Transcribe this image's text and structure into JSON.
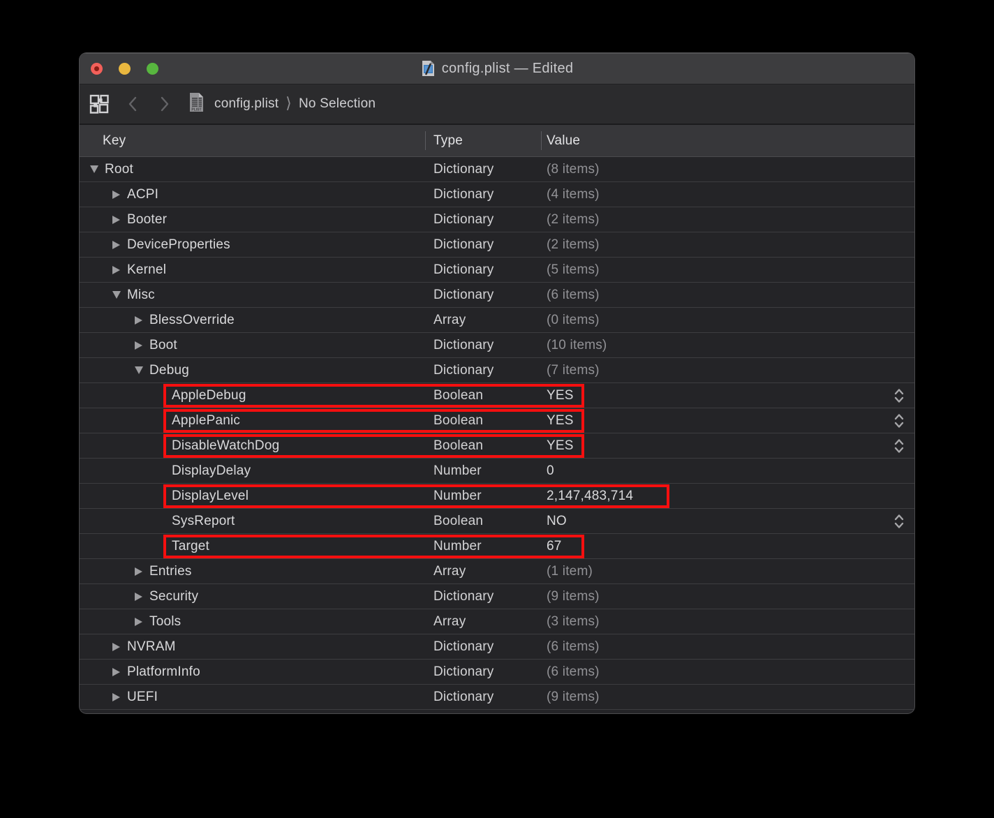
{
  "window": {
    "title": "config.plist — Edited"
  },
  "toolbar": {
    "breadcrumb": [
      {
        "label": "config.plist"
      },
      {
        "label": "No Selection"
      }
    ],
    "separator": "⟩"
  },
  "table": {
    "columns": [
      {
        "label": "Key"
      },
      {
        "label": "Type"
      },
      {
        "label": "Value"
      }
    ],
    "rows": [
      {
        "key": "Root",
        "type": "Dictionary",
        "value": "(8 items)",
        "indent": 0,
        "disclosure": "open",
        "stepper": false,
        "highlight": null
      },
      {
        "key": "ACPI",
        "type": "Dictionary",
        "value": "(4 items)",
        "indent": 1,
        "disclosure": "closed",
        "stepper": false,
        "highlight": null
      },
      {
        "key": "Booter",
        "type": "Dictionary",
        "value": "(2 items)",
        "indent": 1,
        "disclosure": "closed",
        "stepper": false,
        "highlight": null
      },
      {
        "key": "DeviceProperties",
        "type": "Dictionary",
        "value": "(2 items)",
        "indent": 1,
        "disclosure": "closed",
        "stepper": false,
        "highlight": null
      },
      {
        "key": "Kernel",
        "type": "Dictionary",
        "value": "(5 items)",
        "indent": 1,
        "disclosure": "closed",
        "stepper": false,
        "highlight": null
      },
      {
        "key": "Misc",
        "type": "Dictionary",
        "value": "(6 items)",
        "indent": 1,
        "disclosure": "open",
        "stepper": false,
        "highlight": null
      },
      {
        "key": "BlessOverride",
        "type": "Array",
        "value": "(0 items)",
        "indent": 2,
        "disclosure": "closed",
        "stepper": false,
        "highlight": null
      },
      {
        "key": "Boot",
        "type": "Dictionary",
        "value": "(10 items)",
        "indent": 2,
        "disclosure": "closed",
        "stepper": false,
        "highlight": null
      },
      {
        "key": "Debug",
        "type": "Dictionary",
        "value": "(7 items)",
        "indent": 2,
        "disclosure": "open",
        "stepper": false,
        "highlight": null
      },
      {
        "key": "AppleDebug",
        "type": "Boolean",
        "value": "YES",
        "indent": 3,
        "disclosure": "none",
        "stepper": true,
        "highlight": "narrow"
      },
      {
        "key": "ApplePanic",
        "type": "Boolean",
        "value": "YES",
        "indent": 3,
        "disclosure": "none",
        "stepper": true,
        "highlight": "narrow"
      },
      {
        "key": "DisableWatchDog",
        "type": "Boolean",
        "value": "YES",
        "indent": 3,
        "disclosure": "none",
        "stepper": true,
        "highlight": "narrow"
      },
      {
        "key": "DisplayDelay",
        "type": "Number",
        "value": "0",
        "indent": 3,
        "disclosure": "none",
        "stepper": false,
        "highlight": null
      },
      {
        "key": "DisplayLevel",
        "type": "Number",
        "value": "2,147,483,714",
        "indent": 3,
        "disclosure": "none",
        "stepper": false,
        "highlight": "wide"
      },
      {
        "key": "SysReport",
        "type": "Boolean",
        "value": "NO",
        "indent": 3,
        "disclosure": "none",
        "stepper": true,
        "highlight": null
      },
      {
        "key": "Target",
        "type": "Number",
        "value": "67",
        "indent": 3,
        "disclosure": "none",
        "stepper": false,
        "highlight": "narrow"
      },
      {
        "key": "Entries",
        "type": "Array",
        "value": "(1 item)",
        "indent": 2,
        "disclosure": "closed",
        "stepper": false,
        "highlight": null
      },
      {
        "key": "Security",
        "type": "Dictionary",
        "value": "(9 items)",
        "indent": 2,
        "disclosure": "closed",
        "stepper": false,
        "highlight": null
      },
      {
        "key": "Tools",
        "type": "Array",
        "value": "(3 items)",
        "indent": 2,
        "disclosure": "closed",
        "stepper": false,
        "highlight": null
      },
      {
        "key": "NVRAM",
        "type": "Dictionary",
        "value": "(6 items)",
        "indent": 1,
        "disclosure": "closed",
        "stepper": false,
        "highlight": null
      },
      {
        "key": "PlatformInfo",
        "type": "Dictionary",
        "value": "(6 items)",
        "indent": 1,
        "disclosure": "closed",
        "stepper": false,
        "highlight": null
      },
      {
        "key": "UEFI",
        "type": "Dictionary",
        "value": "(9 items)",
        "indent": 1,
        "disclosure": "closed",
        "stepper": false,
        "highlight": null
      }
    ]
  },
  "annotations": {
    "highlight_color": "#f50f0f"
  },
  "colors": {
    "close_button": "#f3605a",
    "minimize_button": "#e9b73f",
    "zoom_button": "#58b63f",
    "window_background": "#242427",
    "titlebar_background": "#3d3d3f"
  }
}
